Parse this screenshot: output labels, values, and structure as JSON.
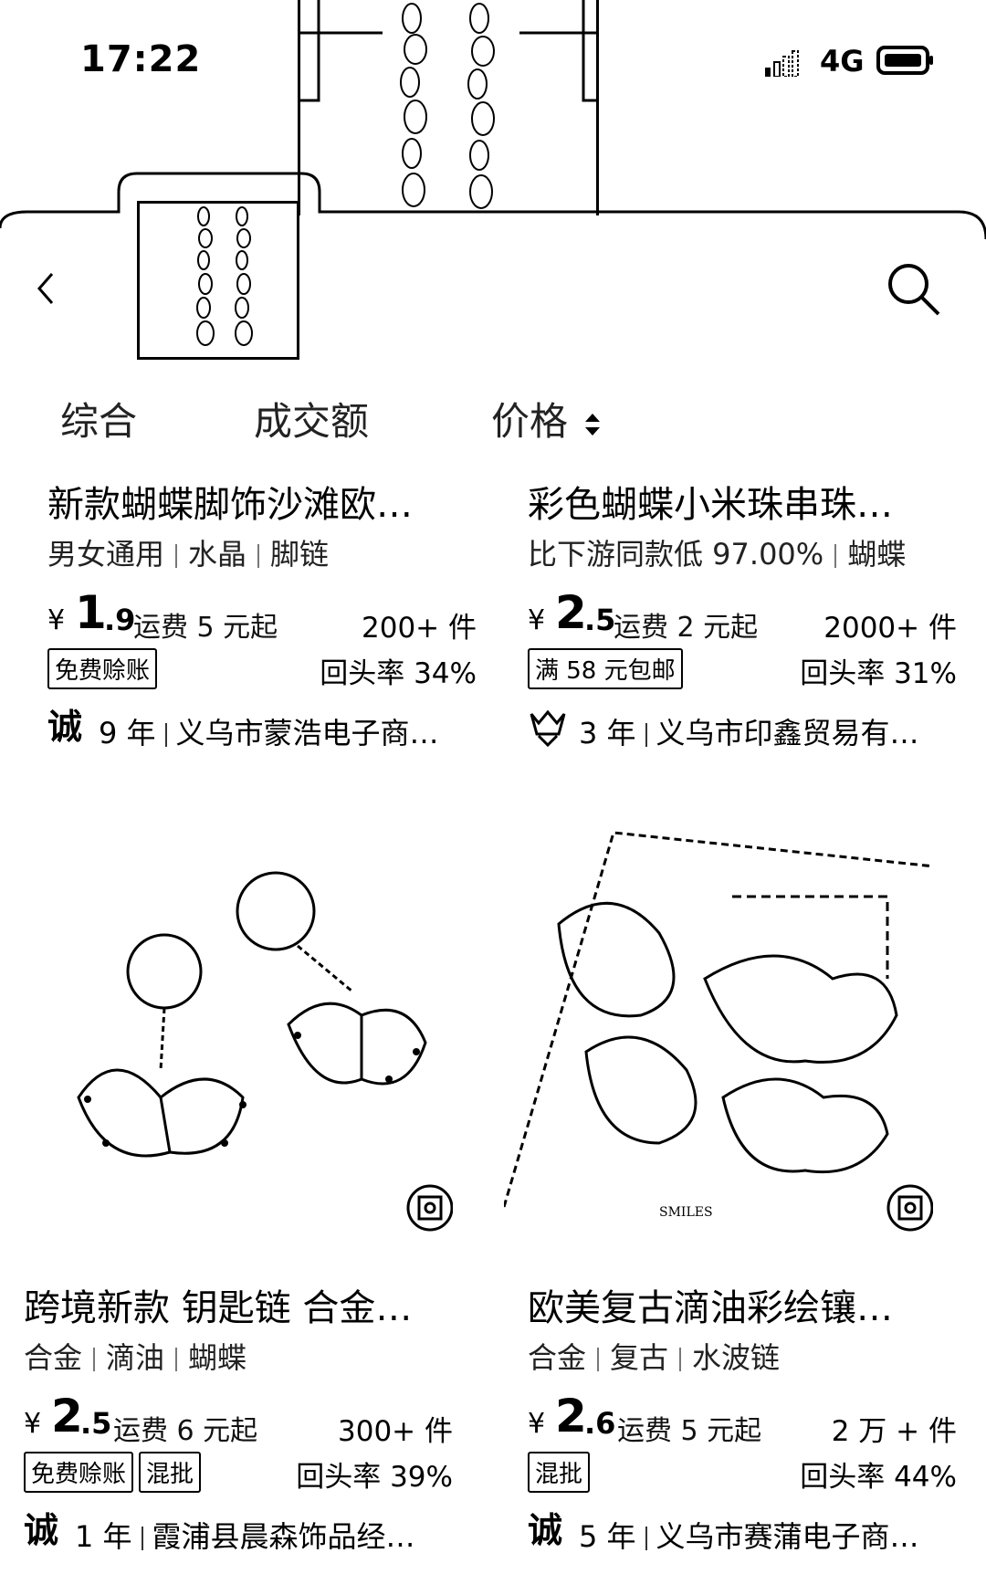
{
  "status_bar": {
    "time": "17:22",
    "network": "4G"
  },
  "header": {
    "back_icon": "chevron-left-icon",
    "search_icon": "search-icon"
  },
  "sort_tabs": [
    {
      "label": "综合"
    },
    {
      "label": "成交额"
    },
    {
      "label": "价格"
    }
  ],
  "products": [
    {
      "title": "新款蝴蝶脚饰沙滩欧…",
      "tags": [
        "男女通用",
        "水晶",
        "脚链"
      ],
      "currency": "¥",
      "price_int": "1",
      "price_dec": ".9",
      "shipping": "运费 5 元起",
      "sold": "200+ 件",
      "badges": [
        "免费赊账"
      ],
      "repeat_rate": "回头率 34%",
      "seller_icon": "诚",
      "seller_years": "9 年",
      "seller_name": "义乌市蒙浩电子商…"
    },
    {
      "title": "彩色蝴蝶小米珠串珠…",
      "tags": [
        "比下游同款低 97.00%",
        "蝴蝶"
      ],
      "currency": "¥",
      "price_int": "2",
      "price_dec": ".5",
      "shipping": "运费 2 元起",
      "sold": "2000+ 件",
      "badges": [
        "满 58 元包邮"
      ],
      "repeat_rate": "回头率 31%",
      "seller_icon": "crown-icon",
      "seller_years": "3 年",
      "seller_name": "义乌市印鑫贸易有…"
    },
    {
      "title": "跨境新款 钥匙链 合金…",
      "tags": [
        "合金",
        "滴油",
        "蝴蝶"
      ],
      "currency": "¥",
      "price_int": "2",
      "price_dec": ".5",
      "shipping": "运费 6 元起",
      "sold": "300+ 件",
      "badges": [
        "免费赊账",
        "混批"
      ],
      "repeat_rate": "回头率 39%",
      "seller_icon": "诚",
      "seller_years": "1 年",
      "seller_name": "霞浦县晨森饰品经…"
    },
    {
      "title": "欧美复古滴油彩绘镶…",
      "tags": [
        "合金",
        "复古",
        "水波链"
      ],
      "currency": "¥",
      "price_int": "2",
      "price_dec": ".6",
      "shipping": "运费 5 元起",
      "sold": "2 万 + 件",
      "badges": [
        "混批"
      ],
      "repeat_rate": "回头率 44%",
      "seller_icon": "诚",
      "seller_years": "5 年",
      "seller_name": "义乌市赛蒲电子商…"
    }
  ],
  "image_texts": {
    "photo_caption": "SMILES"
  }
}
